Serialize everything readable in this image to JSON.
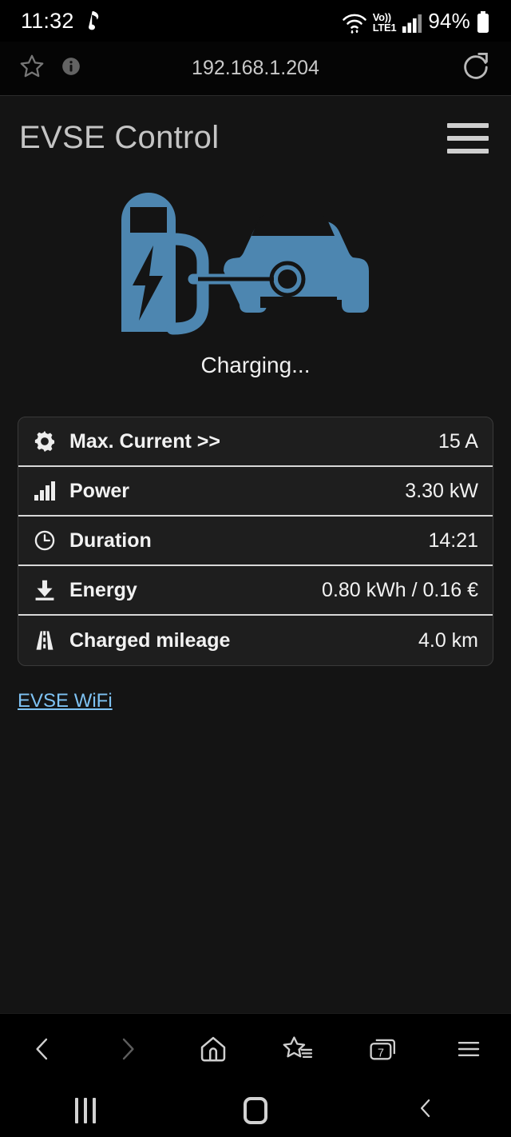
{
  "status_bar": {
    "clock": "11:32",
    "music_icon": "music-note-icon",
    "wifi_icon": "wifi-icon",
    "volte_top": "Vo))",
    "volte_bottom": "LTE1",
    "signal_icon": "signal-bars-icon",
    "battery_percent": "94%",
    "battery_icon": "battery-icon"
  },
  "browser": {
    "bookmark_icon": "star-outline-icon",
    "info_icon": "info-icon",
    "url": "192.168.1.204",
    "reload_icon": "reload-icon",
    "toolbar": {
      "back_icon": "chevron-left-icon",
      "forward_icon": "chevron-right-icon",
      "home_icon": "home-icon",
      "bookmarks_icon": "star-list-icon",
      "tabs_icon": "tabs-icon",
      "tab_count": "7",
      "menu_icon": "hamburger-menu-icon"
    }
  },
  "app": {
    "title": "EVSE Control",
    "menu_icon": "hamburger-menu-icon",
    "illustration_icon": "ev-charging-station-car-icon",
    "illustration_color": "#4d86b0",
    "status_text": "Charging...",
    "link_label": "EVSE WiFi",
    "link_color": "#7ec2f3",
    "rows": [
      {
        "icon": "gear-icon",
        "label": "Max. Current >>",
        "value": "15 A"
      },
      {
        "icon": "signal-bars-icon",
        "label": "Power",
        "value": "3.30 kW"
      },
      {
        "icon": "clock-icon",
        "label": "Duration",
        "value": "14:21"
      },
      {
        "icon": "download-icon",
        "label": "Energy",
        "value": "0.80 kWh / 0.16 €"
      },
      {
        "icon": "road-icon",
        "label": "Charged mileage",
        "value": "4.0 km"
      }
    ]
  },
  "nav_bar": {
    "recents_icon": "recents-icon",
    "home_icon": "home-square-icon",
    "back_icon": "back-chevron-icon"
  }
}
